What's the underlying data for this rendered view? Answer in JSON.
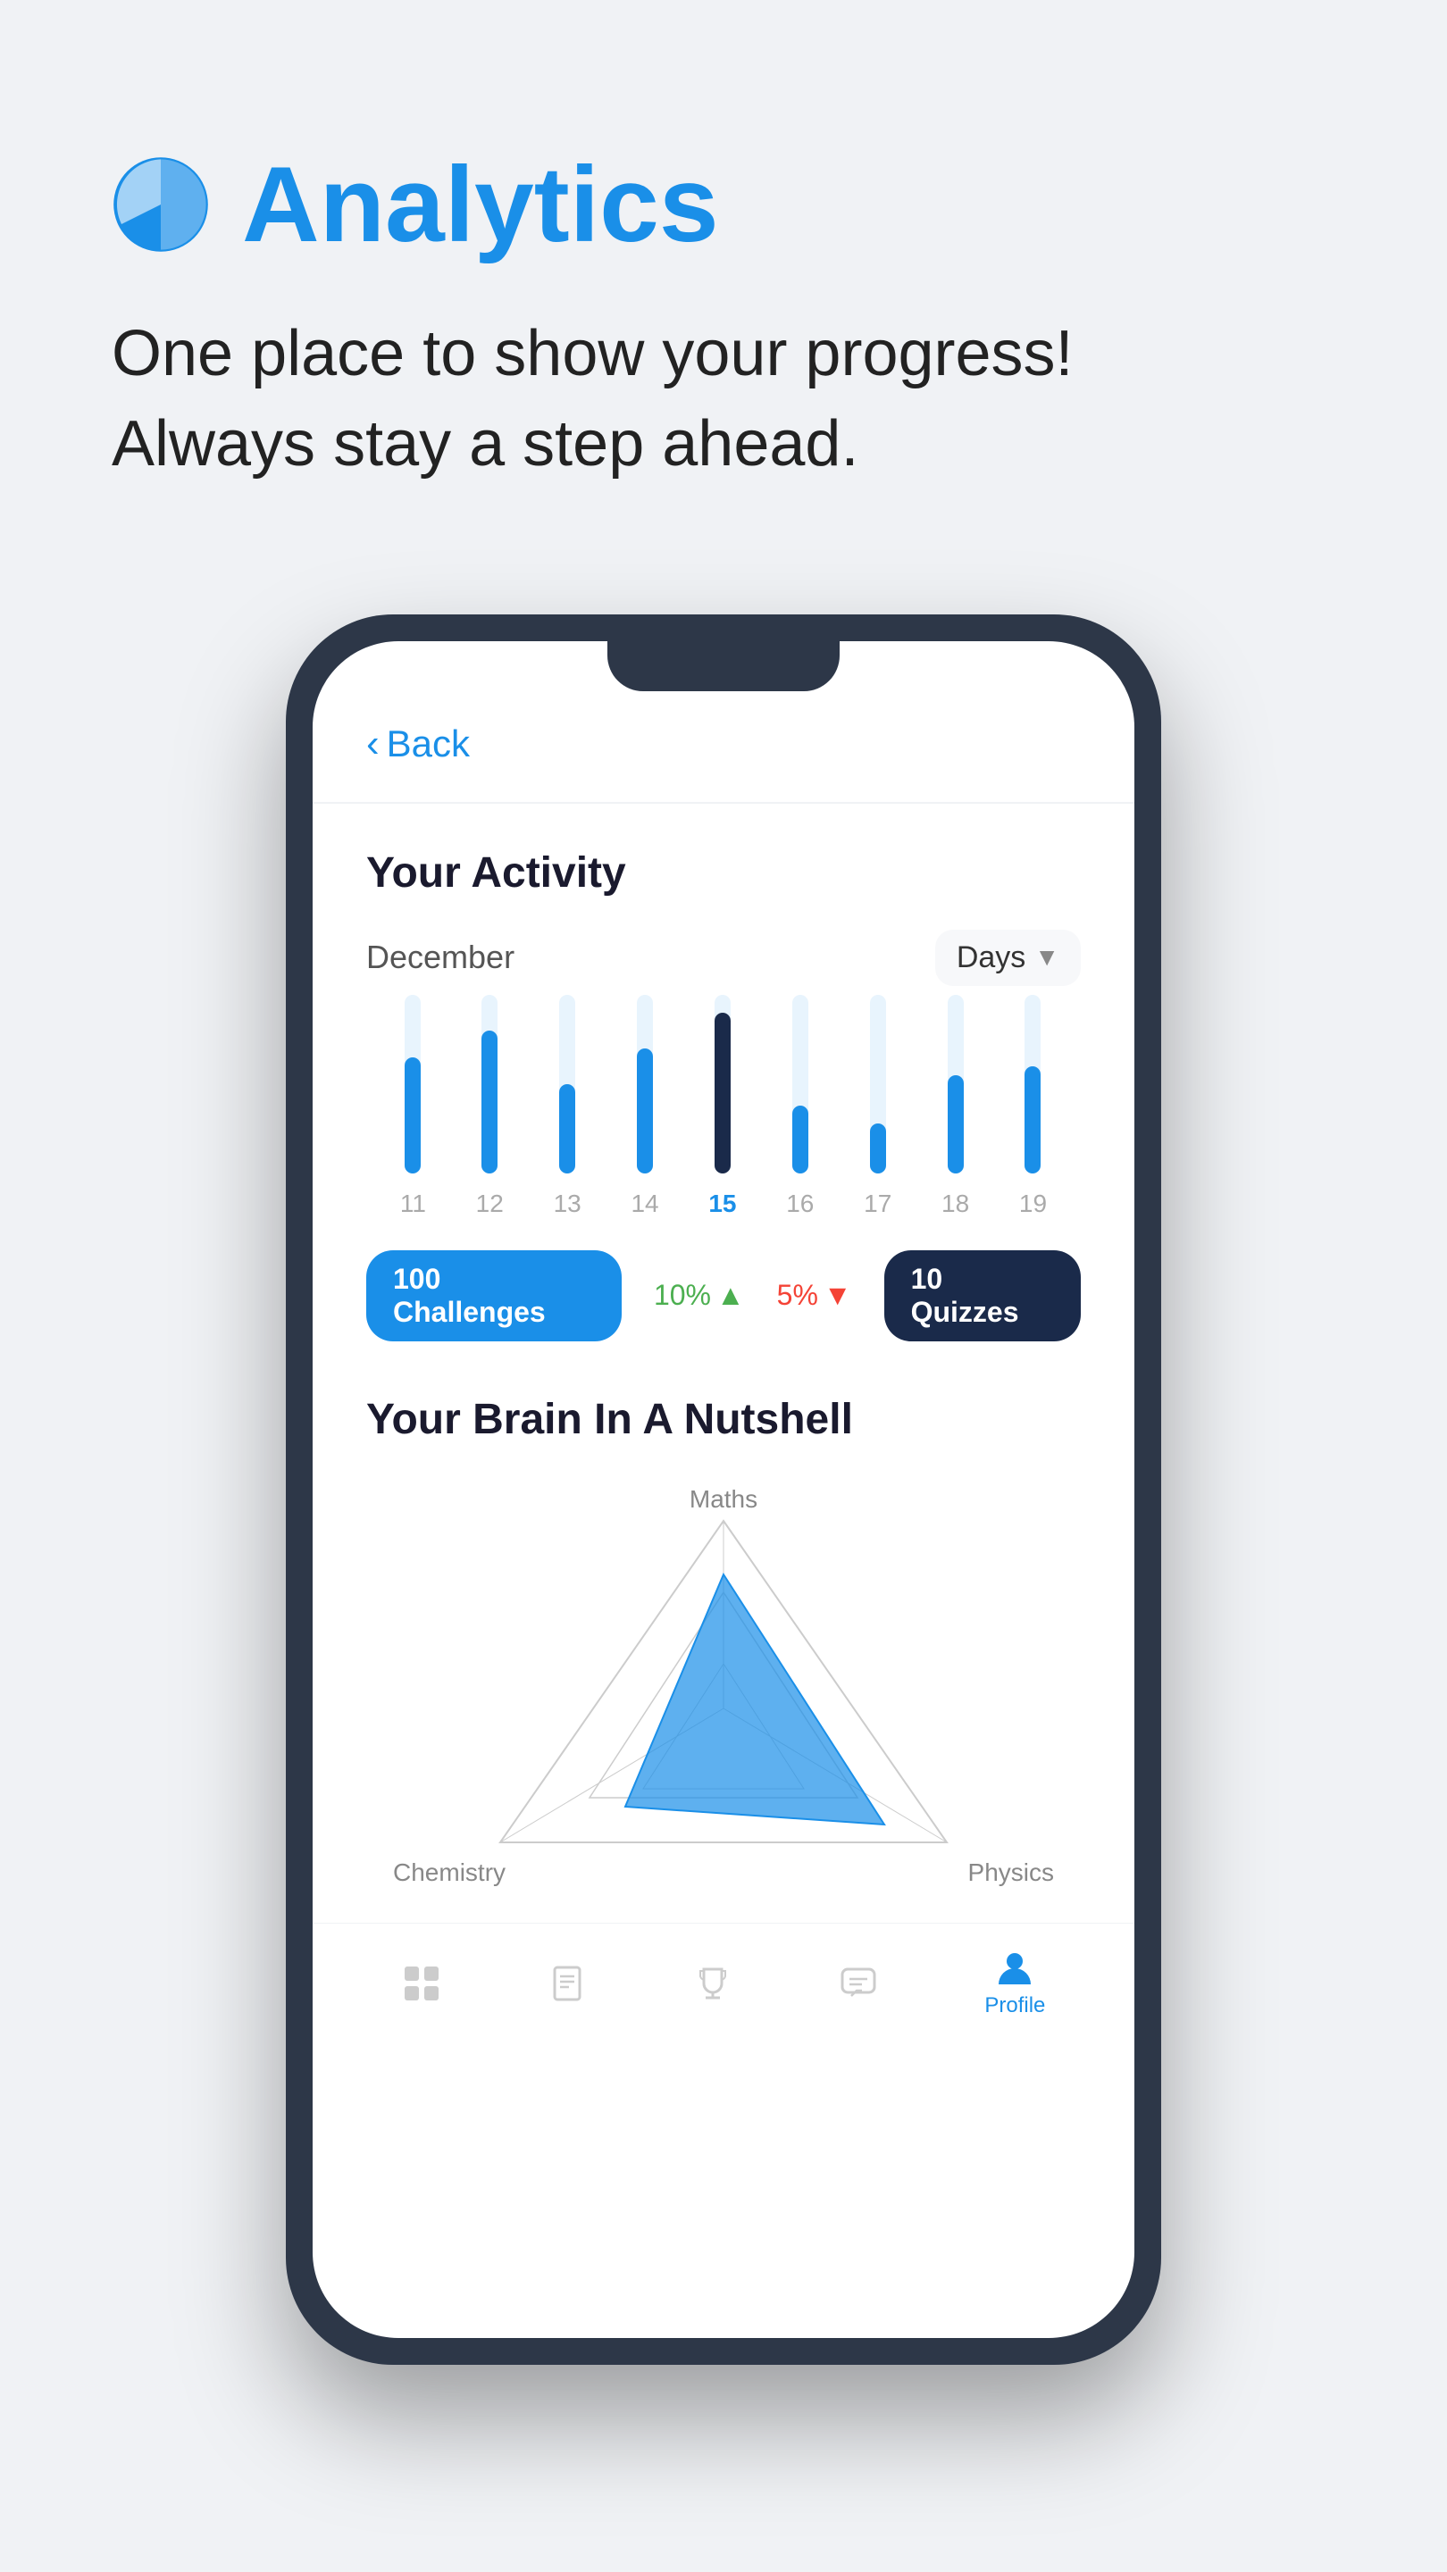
{
  "header": {
    "icon_label": "analytics-pie-icon",
    "title": "Analytics",
    "subtitle_line1": "One place to show your progress!",
    "subtitle_line2": "Always stay a step ahead."
  },
  "phone": {
    "back_label": "Back",
    "activity": {
      "title": "Your Activity",
      "month": "December",
      "filter": "Days",
      "bars": [
        {
          "day": "11",
          "height_pct": 65,
          "active": false
        },
        {
          "day": "12",
          "height_pct": 80,
          "active": false
        },
        {
          "day": "13",
          "height_pct": 50,
          "active": false
        },
        {
          "day": "14",
          "height_pct": 70,
          "active": false
        },
        {
          "day": "15",
          "height_pct": 90,
          "active": true
        },
        {
          "day": "16",
          "height_pct": 40,
          "active": false
        },
        {
          "day": "17",
          "height_pct": 30,
          "active": false
        },
        {
          "day": "18",
          "height_pct": 55,
          "active": false
        },
        {
          "day": "19",
          "height_pct": 60,
          "active": false
        }
      ],
      "badge_challenges": "100 Challenges",
      "stat_up": "10%",
      "stat_down": "5%",
      "badge_quizzes": "10 Quizzes"
    },
    "brain": {
      "title": "Your Brain In A Nutshell",
      "label_top": "Maths",
      "label_bl": "Chemistry",
      "label_br": "Physics"
    },
    "nav": [
      {
        "icon": "grid-icon",
        "label": "",
        "active": false
      },
      {
        "icon": "book-icon",
        "label": "",
        "active": false
      },
      {
        "icon": "trophy-icon",
        "label": "",
        "active": false
      },
      {
        "icon": "chat-icon",
        "label": "",
        "active": false
      },
      {
        "icon": "profile-icon",
        "label": "Profile",
        "active": true
      }
    ]
  }
}
